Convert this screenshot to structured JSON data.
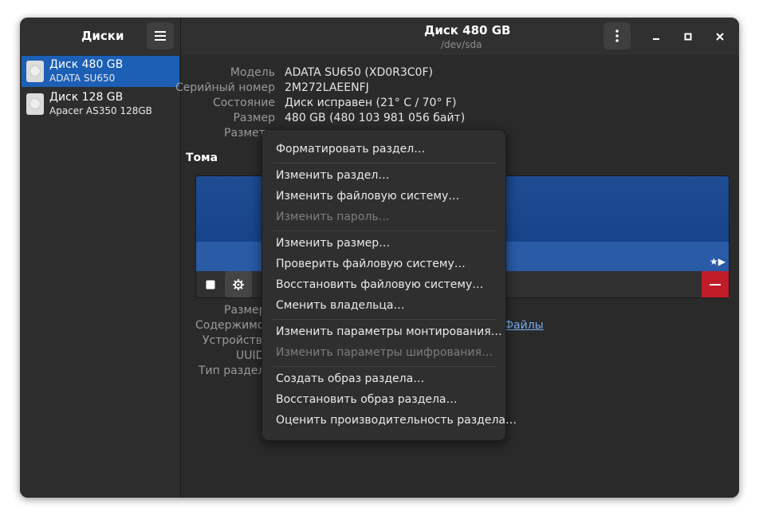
{
  "sidebar": {
    "title": "Диски",
    "disks": [
      {
        "name": "Диск 480 GB",
        "model": "ADATA SU650"
      },
      {
        "name": "Диск 128 GB",
        "model": "Apacer AS350 128GB"
      }
    ]
  },
  "header": {
    "title": "Диск 480 GB",
    "subtitle": "/dev/sda"
  },
  "details": {
    "model_label": "Модель",
    "model_value": "ADATA SU650 (XD0R3C0F)",
    "serial_label": "Серийный номер",
    "serial_value": "2M272LAEENFJ",
    "state_label": "Состояние",
    "state_value": "Диск исправен (21° C / 70° F)",
    "size_label": "Размер",
    "size_value": "480 GB (480 103 981 056 байт)",
    "partitioning_label": "Размет"
  },
  "volumes": {
    "section_title": "Тома",
    "markers": "★▶",
    "size_label": "Размер",
    "contents_label": "Содержимое",
    "device_label": "Устройство",
    "uuid_label": "UUID",
    "type_label": "Тип раздела",
    "files_link": "Файлы"
  },
  "menu": {
    "items": [
      {
        "label": "Форматировать раздел…",
        "enabled": true
      },
      {
        "label": "Изменить раздел…",
        "enabled": true
      },
      {
        "label": "Изменить файловую систему…",
        "enabled": true
      },
      {
        "label": "Изменить пароль…",
        "enabled": false
      },
      {
        "label": "Изменить размер…",
        "enabled": true
      },
      {
        "label": "Проверить файловую систему…",
        "enabled": true
      },
      {
        "label": "Восстановить файловую систему…",
        "enabled": true
      },
      {
        "label": "Сменить владельца…",
        "enabled": true
      },
      {
        "label": "Изменить параметры монтирования…",
        "enabled": true
      },
      {
        "label": "Изменить параметры шифрования…",
        "enabled": false
      },
      {
        "label": "Создать образ раздела…",
        "enabled": true
      },
      {
        "label": "Восстановить образ раздела…",
        "enabled": true
      },
      {
        "label": "Оценить производительность раздела…",
        "enabled": true
      }
    ]
  },
  "colors": {
    "accent": "#1c5fb5",
    "destructive": "#c01c28",
    "link": "#78aeed"
  }
}
